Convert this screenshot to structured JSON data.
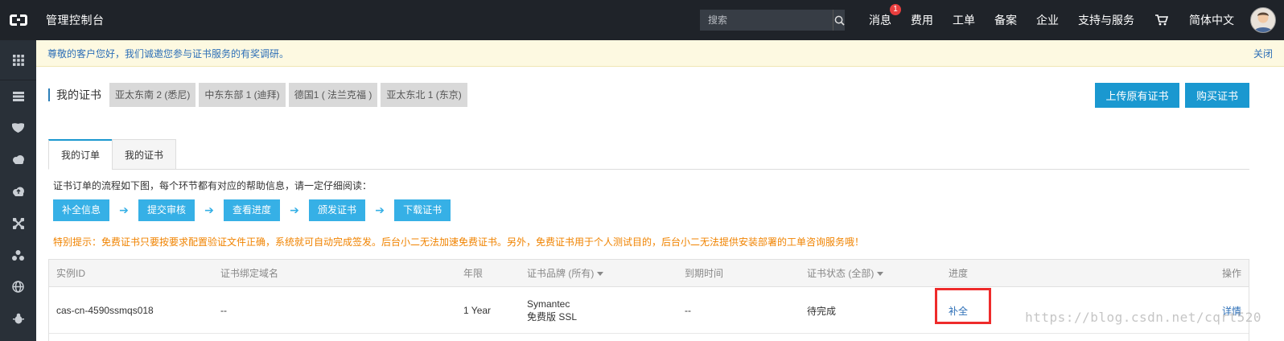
{
  "topbar": {
    "title": "管理控制台",
    "search_placeholder": "搜索",
    "nav": [
      {
        "label": "消息",
        "badge": "1"
      },
      {
        "label": "费用"
      },
      {
        "label": "工单"
      },
      {
        "label": "备案"
      },
      {
        "label": "企业"
      },
      {
        "label": "支持与服务"
      }
    ],
    "language": "简体中文"
  },
  "sidebar": {
    "icons": [
      "grid-icon",
      "server-icon",
      "shield-icon",
      "cloud-icon",
      "cloud-upload-icon",
      "cross-arrows-icon",
      "network-icon",
      "globe-icon",
      "bug-icon"
    ]
  },
  "notice": {
    "text": "尊敬的客户您好，我们诚邀您参与证书服务的有奖调研。",
    "close": "关闭"
  },
  "header": {
    "title": "我的证书",
    "regions": [
      "亚太东南 2 (悉尼)",
      "中东东部 1 (迪拜)",
      "德国1 ( 法兰克福 )",
      "亚太东北 1 (东京)"
    ],
    "upload_button": "上传原有证书",
    "buy_button": "购买证书"
  },
  "tabs": [
    "我的订单",
    "我的证书"
  ],
  "flow": {
    "intro": "证书订单的流程如下图，每个环节都有对应的帮助信息，请一定仔细阅读：",
    "steps": [
      "补全信息",
      "提交审核",
      "查看进度",
      "颁发证书",
      "下载证书"
    ],
    "tip": "特别提示：免费证书只要按要求配置验证文件正确，系统就可自动完成签发。后台小二无法加速免费证书。另外，免费证书用于个人测试目的，后台小二无法提供安装部署的工单咨询服务哦！"
  },
  "table": {
    "headers": [
      "实例ID",
      "证书绑定域名",
      "年限",
      "证书品牌 (所有)",
      "到期时间",
      "证书状态 (全部)",
      "进度",
      "操作"
    ],
    "rows": [
      {
        "id": "cas-cn-4590ssmqs018",
        "domain": "--",
        "years": "1 Year",
        "brand": "Symantec",
        "brand_type": "免费版 SSL",
        "expiry": "--",
        "status": "待完成",
        "progress": "补全",
        "action": "详情"
      }
    ]
  },
  "watermark": "https://blog.csdn.net/cqrt520",
  "colors": {
    "topbar": "#1f2329",
    "sidebar": "#293038",
    "primary": "#1a98d0",
    "flow_step": "#36b0e6",
    "tip": "#f08300",
    "link": "#2d6fb7",
    "highlight": "#ee2b2b"
  }
}
